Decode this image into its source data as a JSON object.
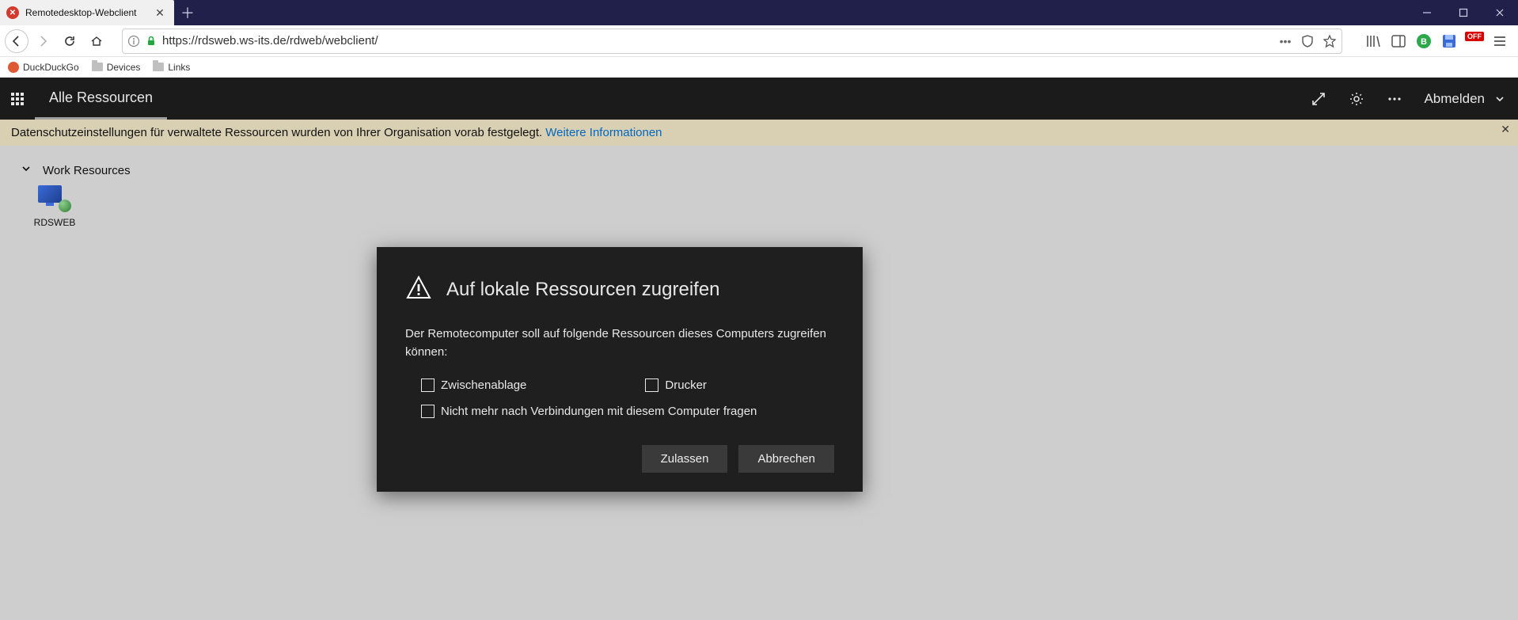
{
  "browser": {
    "tab_title": "Remotedesktop-Webclient",
    "url": "https://rdsweb.ws-its.de/rdweb/webclient/",
    "bookmarks": [
      "DuckDuckGo",
      "Devices",
      "Links"
    ],
    "ext_badge": "OFF"
  },
  "app": {
    "breadcrumb": "Alle Ressourcen",
    "signout": "Abmelden"
  },
  "notice": {
    "text": "Datenschutzeinstellungen für verwaltete Ressourcen wurden von Ihrer Organisation vorab festgelegt.",
    "link": "Weitere Informationen"
  },
  "group": {
    "title": "Work Resources",
    "items": [
      {
        "label": "RDSWEB"
      }
    ]
  },
  "dialog": {
    "title": "Auf lokale Ressourcen zugreifen",
    "body": "Der Remotecomputer soll auf folgende Ressourcen dieses Computers zugreifen können:",
    "opt_clipboard": "Zwischenablage",
    "opt_printer": "Drucker",
    "opt_dontask": "Nicht mehr nach Verbindungen mit diesem Computer fragen",
    "allow": "Zulassen",
    "cancel": "Abbrechen"
  }
}
